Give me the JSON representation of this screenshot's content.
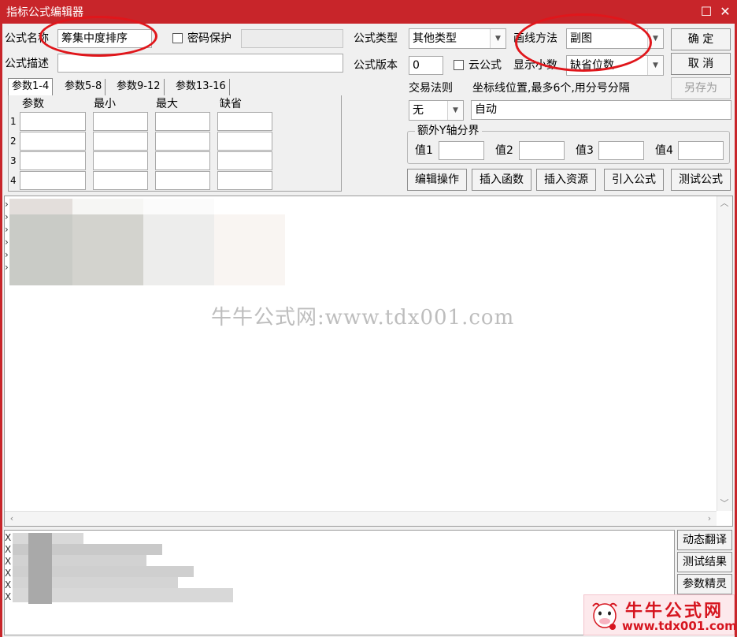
{
  "window": {
    "title": "指标公式编辑器",
    "maximize_icon": "maximize-icon",
    "close_icon": "close-icon"
  },
  "formula": {
    "name_label": "公式名称",
    "name_value": "筹集中度排序",
    "password_label": "密码保护",
    "password_checked": false,
    "password_value": "",
    "desc_label": "公式描述",
    "desc_value": "",
    "type_label": "公式类型",
    "type_value": "其他类型",
    "draw_label": "画线方法",
    "draw_value": "副图",
    "version_label": "公式版本",
    "version_value": "0",
    "cloud_label": "云公式",
    "cloud_checked": false,
    "decimal_label": "显示小数",
    "decimal_value": "缺省位数"
  },
  "buttons": {
    "ok": "确 定",
    "cancel": "取 消",
    "save_as": "另存为"
  },
  "param_tabs": [
    "参数1-4",
    "参数5-8",
    "参数9-12",
    "参数13-16"
  ],
  "param_table": {
    "headers": [
      "参数",
      "最小",
      "最大",
      "缺省"
    ],
    "rows": [
      "1",
      "2",
      "3",
      "4"
    ]
  },
  "trade_rule": {
    "label": "交易法则",
    "value": "无"
  },
  "axis_position": {
    "label": "坐标线位置,最多6个,用分号分隔",
    "value": "自动"
  },
  "extra_y": {
    "label": "额外Y轴分界",
    "values": [
      "值1",
      "值2",
      "值3",
      "值4"
    ]
  },
  "toolbar": [
    "编辑操作",
    "插入函数",
    "插入资源",
    "引入公式",
    "测试公式"
  ],
  "watermark": "牛牛公式网:www.tdx001.com",
  "side_buttons": [
    "动态翻译",
    "测试结果",
    "参数精灵"
  ],
  "logo": {
    "name": "牛牛公式网",
    "url": "www.tdx001.com"
  },
  "colors": {
    "titlebar": "#c8252a",
    "annotation": "#e0161b",
    "logo": "#d6151f"
  }
}
